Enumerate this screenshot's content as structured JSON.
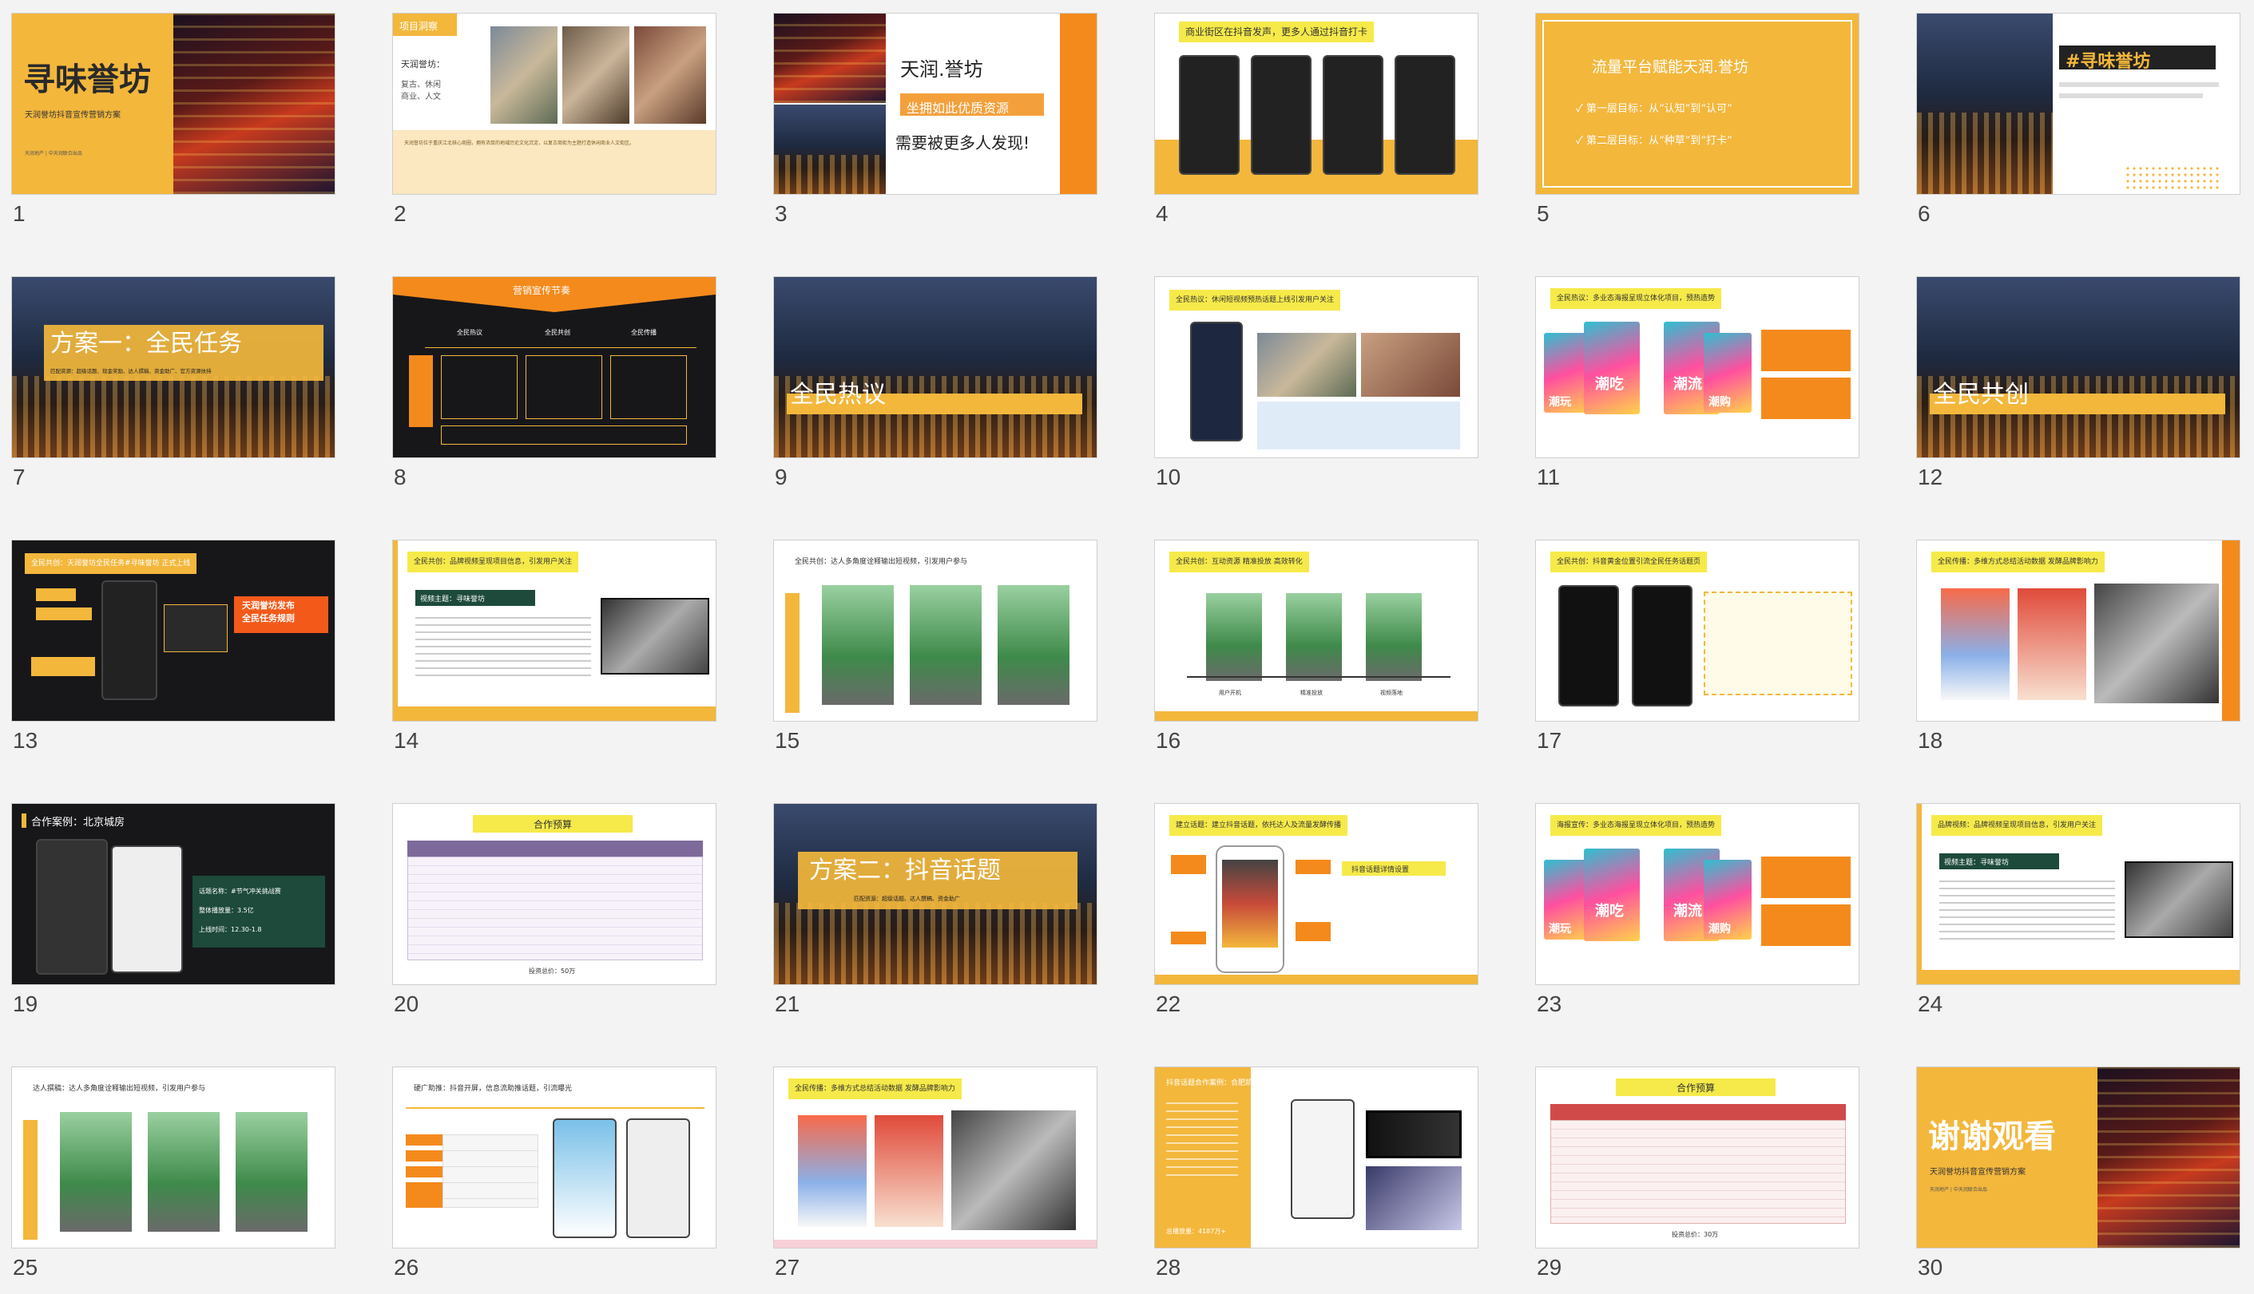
{
  "slides": [
    {
      "n": "1",
      "title": "寻味誉坊",
      "subtitle": "天润誉坊抖音宣传营销方案",
      "small": "天润地产 | 中天润联合出品"
    },
    {
      "n": "2",
      "tag": "项目洞察",
      "name": "天润誉坊：",
      "desc": "复古、休闲\n商业、人文",
      "body": "天润誉坊位于重庆江北核心商圈，拥有浓厚的地域历史文化沉淀，以复古商街为主题打造休闲商业人文街区。"
    },
    {
      "n": "3",
      "title": "天润.誉坊",
      "highlight": "坐拥如此优质资源",
      "line": "需要被更多人发现!"
    },
    {
      "n": "4",
      "title": "商业街区在抖音发声，更多人通过抖音打卡"
    },
    {
      "n": "5",
      "title": "流量平台赋能天润.誉坊",
      "goal1": "✓ 第一层目标：从“认知”到“认可”",
      "goal2": "✓ 第二层目标：从“种草”到“打卡”"
    },
    {
      "n": "6",
      "title": "#寻味誉坊"
    },
    {
      "n": "7",
      "title": "方案一：全民任务",
      "sub": "匹配资源：超级话题、现金奖励、达人撰稿、资金助广、官方资源扶持"
    },
    {
      "n": "8",
      "title": "营销宣传节奏",
      "cols": [
        "全民热议",
        "全民共创",
        "全民传播"
      ]
    },
    {
      "n": "9",
      "title": "全民热议"
    },
    {
      "n": "10",
      "title": "全民热议：休闲短视频预热话题上线引发用户关注"
    },
    {
      "n": "11",
      "title": "全民热议：多业态海报呈现立体化项目，预热造势",
      "tags": [
        "潮吃",
        "潮流",
        "潮玩",
        "潮购"
      ]
    },
    {
      "n": "12",
      "title": "全民共创"
    },
    {
      "n": "13",
      "title": "全民共创：天润誉坊全民任务#寻味誉坊 正式上线",
      "callout": "天润誉坊发布\n全民任务规则"
    },
    {
      "n": "14",
      "title": "全民共创：品牌视频呈现项目信息，引发用户关注",
      "label": "视频主题：寻味誉坊"
    },
    {
      "n": "15",
      "title": "全民共创：达人多角度诠释输出短视频，引发用户参与"
    },
    {
      "n": "16",
      "title": "全民共创：互动资源 精准投放 高效转化",
      "captions": [
        "用户开机",
        "精准投放",
        "视频落地"
      ]
    },
    {
      "n": "17",
      "title": "全民共创：抖音黄金位置引流全民任务话题页"
    },
    {
      "n": "18",
      "title": "全民传播：多维方式总结活动数据 发酵品牌影响力"
    },
    {
      "n": "19",
      "title": "合作案例：北京城房",
      "stats": [
        "话题名称：#节气冲关挑战赛",
        "整体播放量：3.5亿",
        "上线时间：12.30-1.8"
      ]
    },
    {
      "n": "20",
      "title": "合作预算",
      "total": "投资总价：50万"
    },
    {
      "n": "21",
      "title": "方案二：抖音话题",
      "sub": "匹配资源：超级话题、达人撰稿、资金助广"
    },
    {
      "n": "22",
      "title": "建立话题：建立抖音话题，依托达人及流量发酵传播",
      "label": "抖音话题详情设置"
    },
    {
      "n": "23",
      "title": "海报宣传：多业态海报呈现立体化项目，预热造势",
      "tags": [
        "潮吃",
        "潮流",
        "潮玩",
        "潮购"
      ]
    },
    {
      "n": "24",
      "title": "品牌视频：品牌视频呈现项目信息，引发用户关注",
      "label": "视频主题：寻味誉坊"
    },
    {
      "n": "25",
      "title": "达人撰稿：达人多角度诠释输出短视频，引发用户参与"
    },
    {
      "n": "26",
      "title": "硬广助推：抖音开屏，信息流助推话题，引流曝光"
    },
    {
      "n": "27",
      "title": "全民传播：多维方式总结活动数据 发酵品牌影响力"
    },
    {
      "n": "28",
      "title": "抖音话题合作案例：合肥凯都",
      "total": "总播放量：4187万+"
    },
    {
      "n": "29",
      "title": "合作预算",
      "total": "投资总价：30万"
    },
    {
      "n": "30",
      "title": "谢谢观看",
      "subtitle": "天润誉坊抖音宣传营销方案",
      "small": "天润地产 | 中天润联合出品"
    }
  ],
  "colors": {
    "accent_yellow": "#f3b73c",
    "highlight_yellow": "#f6ea4a",
    "orange": "#f48a1c",
    "dark": "#17171a"
  }
}
